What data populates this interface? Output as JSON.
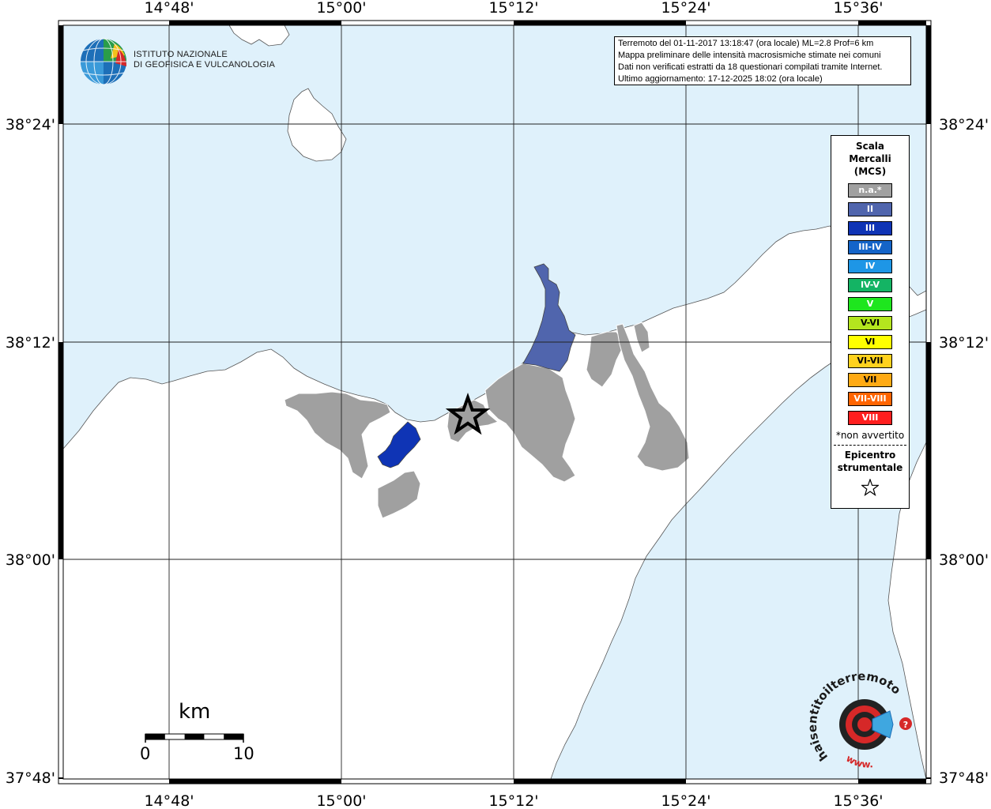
{
  "ticks": {
    "lon": [
      "14°48'",
      "15°00'",
      "15°12'",
      "15°24'",
      "15°36'"
    ],
    "lat": [
      "38°24'",
      "38°12'",
      "38°00'",
      "37°48'"
    ]
  },
  "info": {
    "line1": "Terremoto del 01-11-2017 13:18:47 (ora locale) ML=2.8 Prof=6 km",
    "line2": "Mappa preliminare delle intensità macrosismiche stimate nei comuni",
    "line3": "Dati non verificati estratti da 18 questionari compilati tramite Internet.",
    "line4": "Ultimo aggiornamento: 17-12-2025 18:02 (ora locale)"
  },
  "logo": {
    "line1": "ISTITUTO NAZIONALE",
    "line2": "DI GEOFISICA E VULCANOLOGIA"
  },
  "legend": {
    "title1": "Scala",
    "title2": "Mercalli",
    "title3": "(MCS)",
    "items": [
      {
        "label": "n.a.*",
        "color": "#a0a0a0"
      },
      {
        "label": "II",
        "color": "#5065ad"
      },
      {
        "label": "III",
        "color": "#0f34b5"
      },
      {
        "label": "III-IV",
        "color": "#1464c8"
      },
      {
        "label": "IV",
        "color": "#1e96e6"
      },
      {
        "label": "IV-V",
        "color": "#14b464"
      },
      {
        "label": "V",
        "color": "#1ee61e"
      },
      {
        "label": "V-VI",
        "color": "#b4e61e"
      },
      {
        "label": "VI",
        "color": "#ffff00"
      },
      {
        "label": "VI-VII",
        "color": "#ffd21e"
      },
      {
        "label": "VII",
        "color": "#ffaa14"
      },
      {
        "label": "VII-VIII",
        "color": "#ff6400"
      },
      {
        "label": "VIII",
        "color": "#ff1e1e"
      }
    ],
    "note": "*non avvertito",
    "epi1": "Epicentro",
    "epi2": "strumentale"
  },
  "scale": {
    "unit": "km",
    "min": "0",
    "max": "10"
  },
  "brand": {
    "text": "haisentitoilterremoto.it",
    "www": "www."
  },
  "colors": {
    "sea": "#dff1fb",
    "land": "#ffffff",
    "na": "#a0a0a0",
    "ii": "#5065ad",
    "iii": "#0f34b5"
  }
}
